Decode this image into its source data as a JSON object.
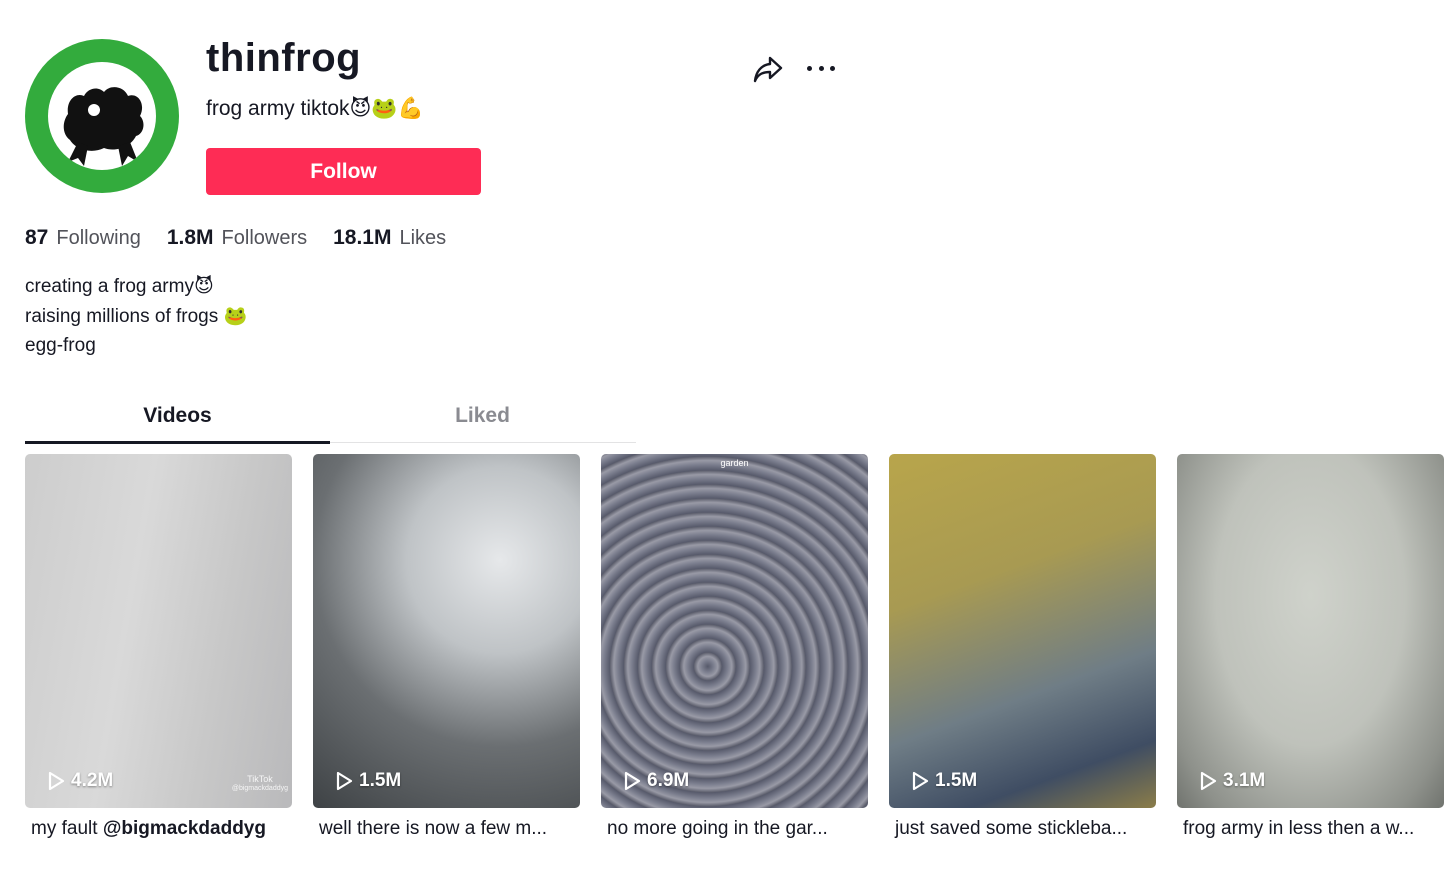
{
  "profile": {
    "username": "thinfrog",
    "subtitle": "frog army tiktok😈🐸💪",
    "follow_label": "Follow",
    "avatar_color": "#33ab3d"
  },
  "header_icons": {
    "share": "share-icon",
    "more": "more-icon"
  },
  "stats": [
    {
      "value": "87",
      "label": "Following"
    },
    {
      "value": "1.8M",
      "label": "Followers"
    },
    {
      "value": "18.1M",
      "label": "Likes"
    }
  ],
  "bio": [
    "creating a frog army😈",
    "raising millions of frogs 🐸",
    "egg-frog"
  ],
  "tabs": [
    {
      "label": "Videos",
      "active": true
    },
    {
      "label": "Liked",
      "active": false
    }
  ],
  "videos": [
    {
      "plays": "4.2M",
      "caption_text": "my fault ",
      "caption_mention": "@bigmackdaddyg",
      "watermark": "TikTok",
      "watermark_handle": "@bigmackdaddyg"
    },
    {
      "plays": "1.5M",
      "caption_text": "well there is now a few m...",
      "caption_mention": ""
    },
    {
      "plays": "6.9M",
      "caption_text": "no more going in the gar...",
      "caption_mention": "",
      "overlay_text": "garden"
    },
    {
      "plays": "1.5M",
      "caption_text": "just saved some stickleba...",
      "caption_mention": ""
    },
    {
      "plays": "3.1M",
      "caption_text": "frog army in less then a w...",
      "caption_mention": ""
    }
  ],
  "colors": {
    "accent": "#fe2c55",
    "text": "#161823",
    "muted": "#8a8b91"
  }
}
